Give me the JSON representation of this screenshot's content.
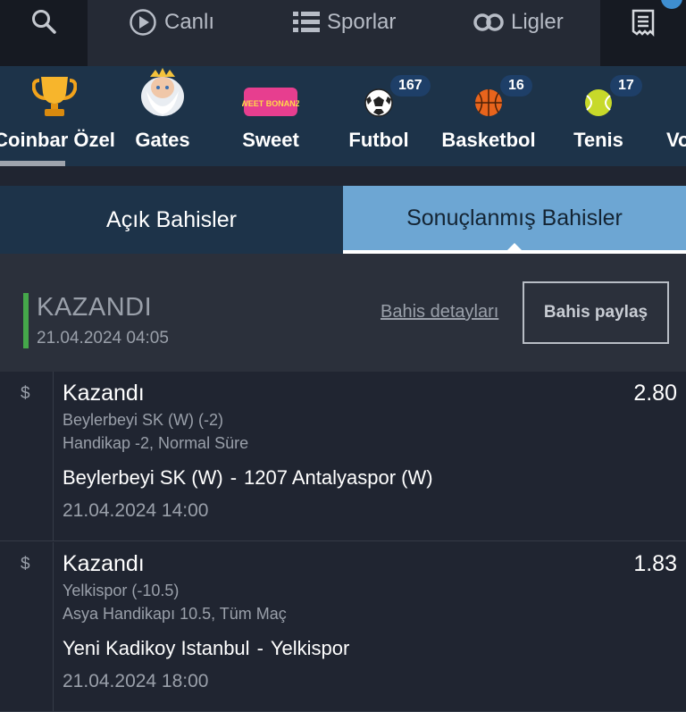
{
  "nav": {
    "live": "Canlı",
    "sports": "Sporlar",
    "leagues": "Ligler"
  },
  "categories": [
    {
      "label": "Coinbar Özel",
      "icon": "trophy-icon"
    },
    {
      "label": "Gates",
      "icon": "zeus-icon"
    },
    {
      "label": "Sweet",
      "icon": "sweet-bonanza-icon",
      "logo_text": "SWEET BONANZA"
    },
    {
      "label": "Futbol",
      "icon": "soccer-ball-icon",
      "count": "167"
    },
    {
      "label": "Basketbol",
      "icon": "basketball-icon",
      "count": "16"
    },
    {
      "label": "Tenis",
      "icon": "tennis-ball-icon",
      "count": "17"
    },
    {
      "label": "Vo",
      "icon": "volleyball-icon"
    }
  ],
  "tabs": {
    "open": "Açık Bahisler",
    "settled": "Sonuçlanmış Bahisler"
  },
  "summary": {
    "status": "KAZANDI",
    "datetime": "21.04.2024  04:05",
    "details_link": "Bahis detayları",
    "share_button": "Bahis paylaş"
  },
  "bets": [
    {
      "icon": "$",
      "result": "Kazandı",
      "odds": "2.80",
      "selection": "Beylerbeyi SK (W) (-2)",
      "market": "Handikap -2, Normal Süre",
      "home": "Beylerbeyi SK (W)",
      "separator": "-",
      "away": "1207 Antalyaspor (W)",
      "time": "21.04.2024  14:00"
    },
    {
      "icon": "$",
      "result": "Kazandı",
      "odds": "1.83",
      "selection": "Yelkispor (-10.5)",
      "market": "Asya Handikapı 10.5, Tüm Maç",
      "home": "Yeni Kadikoy Istanbul",
      "separator": "-",
      "away": "Yelkispor",
      "time": "21.04.2024  18:00"
    }
  ],
  "colors": {
    "win_green": "#45a84a",
    "active_tab": "#6da6d3",
    "category_bg": "#1d3349"
  }
}
